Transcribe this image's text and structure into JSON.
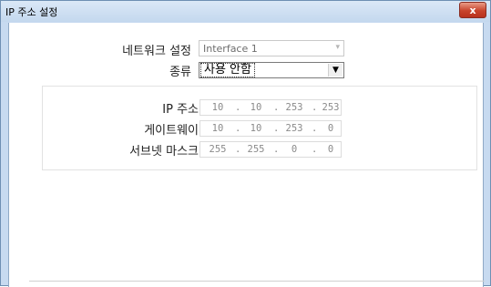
{
  "window": {
    "title": "IP 주소 설정",
    "close_icon": "x"
  },
  "form": {
    "network_label": "네트워크 설정",
    "network_value": "Interface 1",
    "type_label": "종류",
    "type_value": "사용 안함",
    "ip_label": "IP 주소",
    "ip_value": [
      "10",
      "10",
      "253",
      "253"
    ],
    "gateway_label": "게이트웨이",
    "gateway_value": [
      "10",
      "10",
      "253",
      "0"
    ],
    "subnet_label": "서브넷 마스크",
    "subnet_value": [
      "255",
      "255",
      "0",
      "0"
    ]
  },
  "colors": {
    "title_bar": "#c4d8ee",
    "close_button": "#c8432b"
  }
}
